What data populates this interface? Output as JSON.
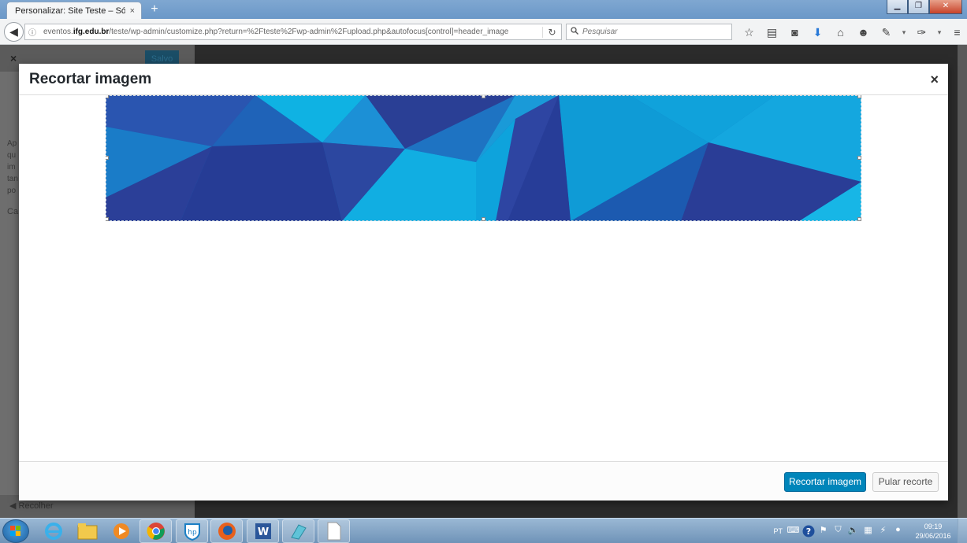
{
  "browser": {
    "tab_title": "Personalizar: Site Teste – Só m...",
    "tab_close": "×",
    "new_tab": "+",
    "url_prefix": "eventos.",
    "url_domain": "ifg.edu.br",
    "url_path": "/teste/wp-admin/customize.php?return=%2Fteste%2Fwp-admin%2Fupload.php&autofocus[control]=header_image",
    "search_placeholder": "Pesquisar",
    "icons": [
      "bookmark-star-icon",
      "reading-list-icon",
      "pocket-icon",
      "download-icon",
      "home-icon",
      "chat-icon",
      "extension-icon",
      "tools-icon",
      "menu-icon"
    ]
  },
  "wp": {
    "close": "×",
    "save_label": "Salvo",
    "side_text": [
      "Ap",
      "qu",
      "im",
      "tan",
      "po"
    ],
    "side_heading": "Ca",
    "collapse_label": "Recolher"
  },
  "modal": {
    "title": "Recortar imagem",
    "close": "×",
    "crop_button": "Recortar imagem",
    "skip_button": "Pular recorte"
  },
  "taskbar": {
    "lang": "PT",
    "time": "09:19",
    "date": "29/06/2016",
    "apps": [
      "internet-explorer",
      "file-explorer",
      "media-player",
      "chrome",
      "hp-app",
      "firefox",
      "word",
      "app-cyan",
      "blank-document"
    ]
  },
  "colors": {
    "accent": "#0085ba",
    "banner_dark": "#243a8c",
    "banner_light": "#0fb4e0"
  }
}
